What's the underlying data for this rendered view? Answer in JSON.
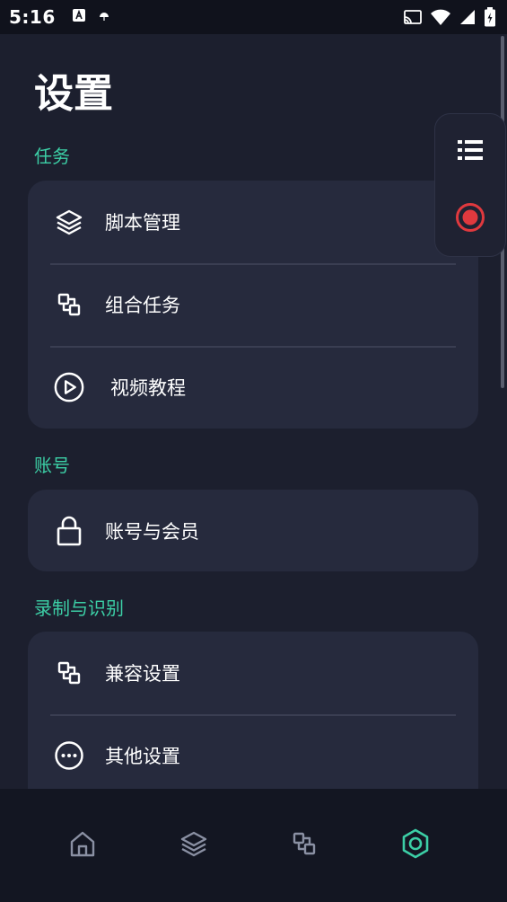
{
  "status_bar": {
    "time": "5:16",
    "icons": [
      "a-badge-icon",
      "umbrella-icon",
      "cast-icon",
      "wifi-icon",
      "signal-icon",
      "battery-icon"
    ]
  },
  "page": {
    "title": "设置"
  },
  "sections": [
    {
      "label": "任务",
      "items": [
        {
          "label": "脚本管理",
          "icon": "layers-icon"
        },
        {
          "label": "组合任务",
          "icon": "combine-icon"
        },
        {
          "label": "视频教程",
          "icon": "play-circle-icon"
        }
      ]
    },
    {
      "label": "账号",
      "items": [
        {
          "label": "账号与会员",
          "icon": "lock-icon"
        }
      ]
    },
    {
      "label": "录制与识别",
      "items": [
        {
          "label": "兼容设置",
          "icon": "combine-icon"
        },
        {
          "label": "其他设置",
          "icon": "more-circle-icon"
        }
      ]
    }
  ],
  "floating_panel": {
    "buttons": [
      "list-icon",
      "record-icon"
    ]
  },
  "bottom_nav": {
    "items": [
      "home-icon",
      "layers-icon",
      "combine-icon",
      "settings-icon"
    ],
    "active_index": 3
  },
  "colors": {
    "background": "#1c1f2e",
    "card": "#262a3d",
    "accent": "#3ccfa6",
    "record": "#e0393e",
    "nav_inactive": "#8a90a3"
  }
}
